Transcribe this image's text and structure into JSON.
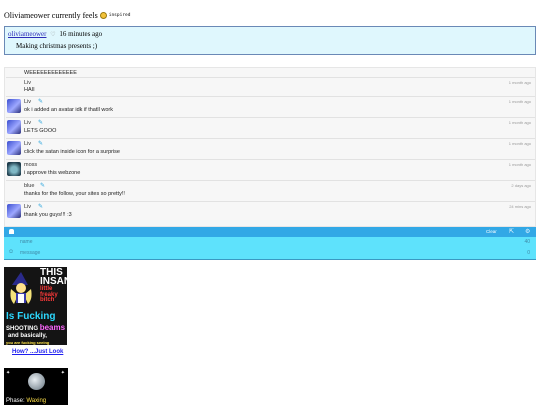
{
  "feels": {
    "prefix": "Oliviameower currently feels",
    "mood": "inspired"
  },
  "status": {
    "user": "oliviameower",
    "time": "16 minutes ago",
    "message": "Making christmas presents ;)"
  },
  "chat": {
    "messages": [
      {
        "name": "",
        "text": "WEEEEEEEEEEEEE",
        "time": "",
        "avatar": ""
      },
      {
        "name": "Liv",
        "text": "HAII",
        "time": "1 month ago",
        "avatar": ""
      },
      {
        "name": "Liv",
        "text": "ok i added an avatar idk if thatll work",
        "time": "1 month ago",
        "avatar": "liv",
        "edit": true
      },
      {
        "name": "Liv",
        "text": "LETS GOOO",
        "time": "1 month ago",
        "avatar": "liv",
        "edit": true
      },
      {
        "name": "Liv",
        "text": "click the satan inside icon for a surprise",
        "time": "1 month ago",
        "avatar": "liv",
        "edit": true
      },
      {
        "name": "moss",
        "text": "i approve this webzone",
        "time": "1 month ago",
        "avatar": "moss"
      },
      {
        "name": "blue",
        "text": "thanks for the follow, your sites so pretty!!",
        "time": "2 days ago",
        "avatar": "",
        "edit": true
      },
      {
        "name": "Liv",
        "text": "thank you guys!!! :3",
        "time": "24 mins ago",
        "avatar": "liv",
        "edit": true
      }
    ],
    "toolbar": {
      "clear_label": "Clear"
    },
    "form": {
      "name_placeholder": "name",
      "name_count": "40",
      "message_placeholder": "message",
      "message_count": "0"
    }
  },
  "stamp": {
    "line1": "THIS",
    "line2": "INSANE",
    "line3": "little freaky bitch",
    "line4": "Is Fucking",
    "line5a": "SHOOTING",
    "line5b": "beams",
    "line6": "and basically,",
    "line7": "you are fucking seeing",
    "link": "How? ...Just Look"
  },
  "moon": {
    "phase_label": "Phase:",
    "phase_value": "Waxing"
  },
  "colors": {
    "chat_bar": "#32a8e6",
    "chat_form": "#5ee2fc",
    "status_bg": "#dff7fd"
  }
}
